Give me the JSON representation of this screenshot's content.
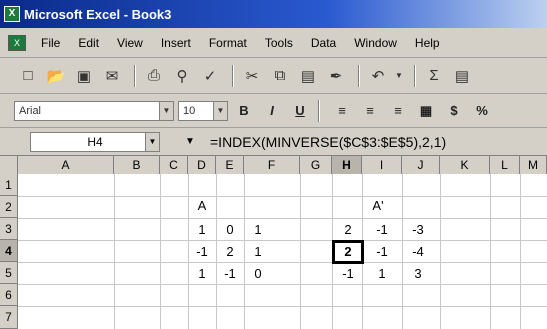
{
  "window": {
    "title": "Microsoft Excel - Book3"
  },
  "menu": [
    "File",
    "Edit",
    "View",
    "Insert",
    "Format",
    "Tools",
    "Data",
    "Window",
    "Help"
  ],
  "toolbar": {
    "icons": [
      "new-icon",
      "open-icon",
      "save-icon",
      "email-icon",
      "print-icon",
      "print-preview-icon",
      "spelling-icon",
      "cut-icon",
      "copy-icon",
      "paste-icon",
      "format-painter-icon",
      "undo-icon",
      "autosum-icon",
      "chart-icon"
    ]
  },
  "format": {
    "font": "Arial",
    "size": "10",
    "buttons": [
      "B",
      "I",
      "U"
    ]
  },
  "formula_bar": {
    "namebox": "H4",
    "formula": "=INDEX(MINVERSE($C$3:$E$5),2,1)"
  },
  "columns": [
    "A",
    "B",
    "C",
    "D",
    "E",
    "F",
    "G",
    "H",
    "I",
    "J",
    "K",
    "L",
    "M"
  ],
  "rows": [
    "1",
    "2",
    "3",
    "4",
    "5",
    "6",
    "7"
  ],
  "active_cell": {
    "column": "H",
    "row": "4"
  },
  "matrix_a": {
    "label": "A",
    "values": [
      [
        "1",
        "0",
        "1"
      ],
      [
        "-1",
        "2",
        "1"
      ],
      [
        "1",
        "-1",
        "0"
      ]
    ]
  },
  "matrix_inverse": {
    "label": "A'",
    "values": [
      [
        "2",
        "-1",
        "-3"
      ],
      [
        "2",
        "-1",
        "-4"
      ],
      [
        "-1",
        "1",
        "3"
      ]
    ]
  }
}
